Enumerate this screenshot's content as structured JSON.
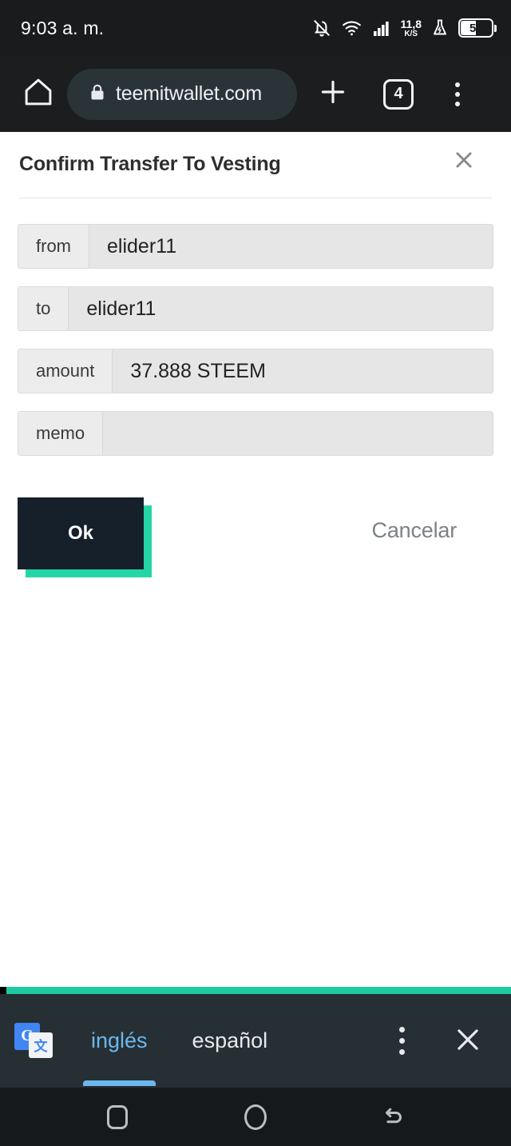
{
  "status_bar": {
    "time": "9:03 a. m.",
    "icons": [
      "notifications-off-icon",
      "wifi-icon",
      "signal-bars-icon",
      "flask-icon"
    ],
    "net_speed_value": "11,8",
    "net_speed_unit": "K/S",
    "battery_level": "51"
  },
  "browser": {
    "home_icon": "home-icon",
    "lock_icon": "lock-icon",
    "url": "teemitwallet.com",
    "new_tab_icon": "plus-icon",
    "tab_count": "4",
    "menu_icon": "overflow-menu-icon"
  },
  "dialog": {
    "title": "Confirm Transfer To Vesting",
    "close_icon": "close-icon",
    "fields": [
      {
        "label": "from",
        "value": "elider11"
      },
      {
        "label": "to",
        "value": "elider11"
      },
      {
        "label": "amount",
        "value": "37.888 STEEM"
      },
      {
        "label": "memo",
        "value": ""
      }
    ],
    "ok_label": "Ok",
    "cancel_label": "Cancelar"
  },
  "translate_bar": {
    "app_icon": "google-translate-icon",
    "app_icon_letter": "G",
    "app_icon_glyph": "文",
    "tab_source": "inglés",
    "tab_target": "español",
    "menu_icon": "overflow-menu-icon",
    "close_icon": "close-icon"
  },
  "nav_bar": {
    "recents": "recents-icon",
    "home": "home-circle-icon",
    "back": "back-arrow-icon"
  },
  "colors": {
    "accent_teal": "#1cc9a0",
    "ok_shadow": "#24d6a5",
    "ok_button": "#16202b",
    "translate_active": "#6bb8ef",
    "status_bar_bg": "#191b1d",
    "browser_bar_bg": "#1b1d1f",
    "translate_bar_bg": "#262f33"
  }
}
